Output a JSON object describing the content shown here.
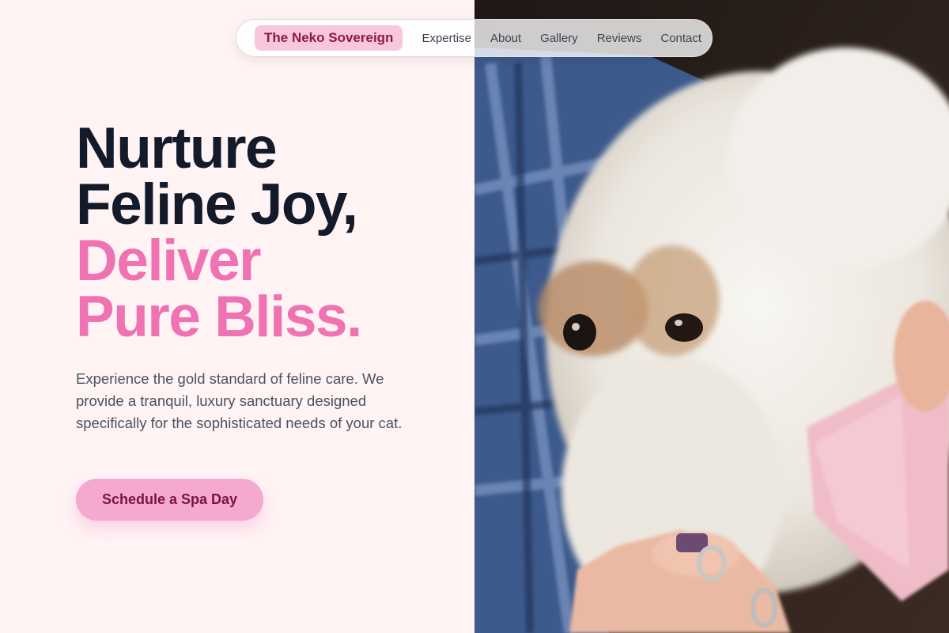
{
  "nav": {
    "brand": "The Neko Sovereign",
    "links": [
      "Expertise",
      "About",
      "Gallery",
      "Reviews",
      "Contact"
    ]
  },
  "hero": {
    "line1": "Nurture",
    "line2": "Feline Joy,",
    "line3": "Deliver",
    "line4": "Pure Bliss.",
    "description": "Experience the gold standard of feline care. We provide a tranquil, luxury sanctuary designed specifically for the sophisticated needs of your cat.",
    "cta": "Schedule a Spa Day"
  },
  "colors": {
    "background": "#fff3f4",
    "accent_pink": "#ef72b3",
    "brand_bg": "#f9c7dc",
    "brand_text": "#8b1a4a",
    "heading_dark": "#131a2a",
    "cta_bg": "#f5a8d0"
  }
}
